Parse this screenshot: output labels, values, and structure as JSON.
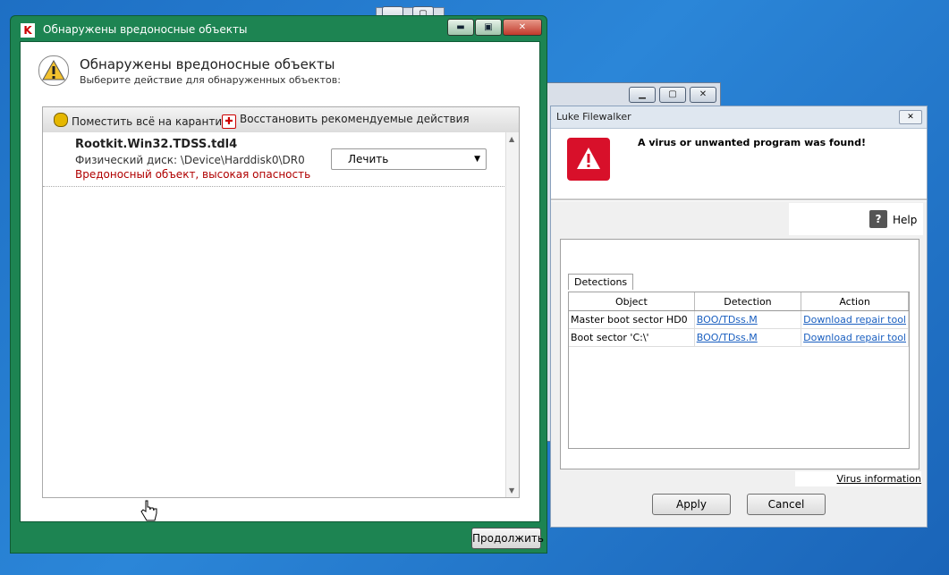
{
  "kav": {
    "title": "Обнаружены вредоносные объекты",
    "heading": "Обнаружены вредоносные объекты",
    "subtitle": "Выберите действие для обнаруженных объектов:",
    "toolbar": {
      "quarantine_all": "Поместить всё на карантин",
      "restore_recommended": "Восстановить рекомендуемые действия"
    },
    "detection": {
      "name": "Rootkit.Win32.TDSS.tdl4",
      "path": "Физический диск: \\Device\\Harddisk0\\DR0",
      "risk": "Вредоносный объект, высокая опасность",
      "action": "Лечить"
    },
    "continue_label": "Продолжить"
  },
  "luke": {
    "title": "Luke Filewalker",
    "message": "A virus or unwanted program was found!",
    "help_label": "Help",
    "tab_label": "Detections",
    "columns": [
      "Object",
      "Detection",
      "Action"
    ],
    "rows": [
      {
        "object": "Master boot sector HD0",
        "detection": "BOO/TDss.M",
        "action": "Download repair tool"
      },
      {
        "object": "Boot sector 'C:\\'",
        "detection": "BOO/TDss.M",
        "action": "Download repair tool"
      }
    ],
    "virus_info_label": "Virus information",
    "apply_label": "Apply",
    "cancel_label": "Cancel"
  }
}
